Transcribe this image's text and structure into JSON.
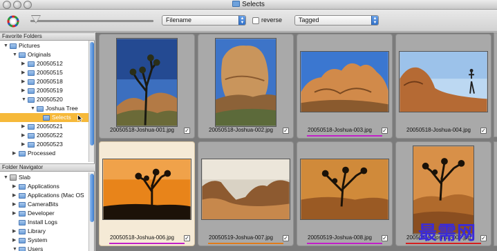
{
  "window": {
    "title": "Selects"
  },
  "toolbar": {
    "sort_select": "Filename",
    "reverse_label": "reverse",
    "filter_select": "Tagged"
  },
  "sidebar": {
    "favorites_header": "Favorite Folders",
    "favorites": [
      {
        "label": "Pictures",
        "expanded": true
      },
      {
        "label": "Originals",
        "expanded": true
      },
      {
        "label": "20050512"
      },
      {
        "label": "20050515"
      },
      {
        "label": "20050518"
      },
      {
        "label": "20050519"
      },
      {
        "label": "20050520",
        "expanded": true
      },
      {
        "label": "Joshua Tree",
        "expanded": true
      },
      {
        "label": "Selects",
        "selected": true
      },
      {
        "label": "20050521"
      },
      {
        "label": "20050522"
      },
      {
        "label": "20050523"
      },
      {
        "label": "Processed"
      }
    ],
    "navigator_header": "Folder Navigator",
    "navigator": [
      {
        "label": "Slab",
        "expanded": true
      },
      {
        "label": "Applications"
      },
      {
        "label": "Applications (Mac OS"
      },
      {
        "label": "CameraBits"
      },
      {
        "label": "Developer"
      },
      {
        "label": "Install Logs"
      },
      {
        "label": "Library"
      },
      {
        "label": "System"
      },
      {
        "label": "Users",
        "expanded": true
      }
    ]
  },
  "thumbnails": [
    {
      "filename": "20050518-Joshua-001.jpg",
      "checked": true,
      "underline_color": ""
    },
    {
      "filename": "20050518-Joshua-002.jpg",
      "checked": true,
      "underline_color": ""
    },
    {
      "filename": "20050518-Joshua-003.jpg",
      "checked": true,
      "underline_color": "#c21fc8"
    },
    {
      "filename": "20050518-Joshua-004.jpg",
      "checked": true,
      "underline_color": ""
    },
    {
      "filename": "20050518-Joshua-006.jpg",
      "checked": true,
      "selected": true,
      "underline_color": "#c21fc8"
    },
    {
      "filename": "20050519-Joshua-007.jpg",
      "checked": true,
      "underline_color": "#e07b1a"
    },
    {
      "filename": "20050519-Joshua-008.jpg",
      "checked": true,
      "underline_color": "#c21fc8"
    },
    {
      "filename": "20050519-Joshua-009.jpg",
      "checked": true,
      "underline_color": "#d42020"
    }
  ],
  "watermark": "最需网",
  "colors": {
    "selection": "#f6b93a",
    "accent_blue": "#3f7fd0"
  }
}
